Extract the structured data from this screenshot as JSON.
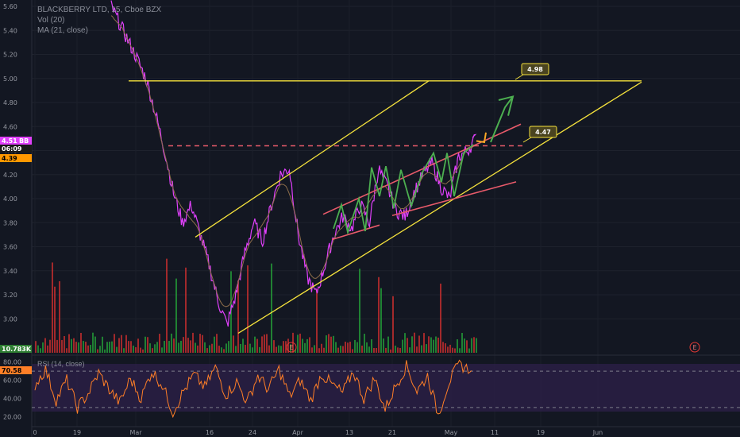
{
  "legend": {
    "symbol": "BLACKBERRY LTD, 15, Cboe BZX",
    "volume": "Vol (20)",
    "ma": "MA (21, close)"
  },
  "rsi_legend": "RSI (14, close)",
  "price_tags": {
    "current": "4.51",
    "symbol_tag": "BB",
    "countdown": "06:09",
    "ma_value": "4.39",
    "volume_value": "10.783K",
    "rsi_value": "70.58"
  },
  "annotations": {
    "resistance_label": "4.98",
    "mid_label": "4.47",
    "event_marker": "E"
  },
  "colors": {
    "background": "#131722",
    "price_line": "#e040fb",
    "trend_yellow": "#f5e23c",
    "channel_red": "#e85a6a",
    "arrows_green": "#4caf50",
    "rsi_line": "#ff7f27",
    "rsi_band": "#2a1e44",
    "vol_up": "#26a63a",
    "vol_down": "#d3302f"
  },
  "chart_data": {
    "type": "line",
    "title": "BLACKBERRY LTD, 15, Cboe BZX",
    "ylim": [
      2.85,
      5.6
    ],
    "y_ticks": [
      "5.60",
      "5.40",
      "5.20",
      "5.00",
      "4.80",
      "4.60",
      "4.40",
      "4.20",
      "4.00",
      "3.80",
      "3.60",
      "3.40",
      "3.20",
      "3.00"
    ],
    "x_ticks": [
      "0",
      "19",
      "Mar",
      "16",
      "24",
      "Apr",
      "13",
      "21",
      "May",
      "11",
      "19",
      "Jun"
    ],
    "series": [
      {
        "values": [
          5.6,
          5.45,
          5.3,
          5.15,
          4.98,
          4.7,
          4.4,
          4.05,
          3.8,
          3.95,
          3.7,
          3.45,
          3.15,
          2.95,
          3.2,
          3.55,
          3.8,
          3.65,
          3.95,
          4.2,
          4.25,
          3.7,
          3.35,
          3.2,
          3.45,
          3.7,
          3.85,
          3.75,
          3.95,
          3.8,
          4.25,
          4.1,
          3.9,
          3.85,
          4.05,
          4.2,
          4.3,
          4.1,
          4.0,
          4.35,
          4.4,
          4.51
        ]
      }
    ],
    "rsi": {
      "ylim": [
        15,
        85
      ],
      "y_ticks": [
        "80.00",
        "60.00",
        "40.00",
        "20.00"
      ],
      "bands": [
        70,
        30
      ],
      "values": [
        55,
        72,
        38,
        60,
        30,
        45,
        68,
        50,
        35,
        62,
        40,
        70,
        55,
        25,
        48,
        66,
        52,
        74,
        44,
        58,
        36,
        65,
        50,
        72,
        42,
        60,
        38,
        67,
        55,
        46,
        70,
        40,
        62,
        28,
        54,
        76,
        48,
        65,
        22,
        58,
        78,
        70.58
      ]
    }
  }
}
